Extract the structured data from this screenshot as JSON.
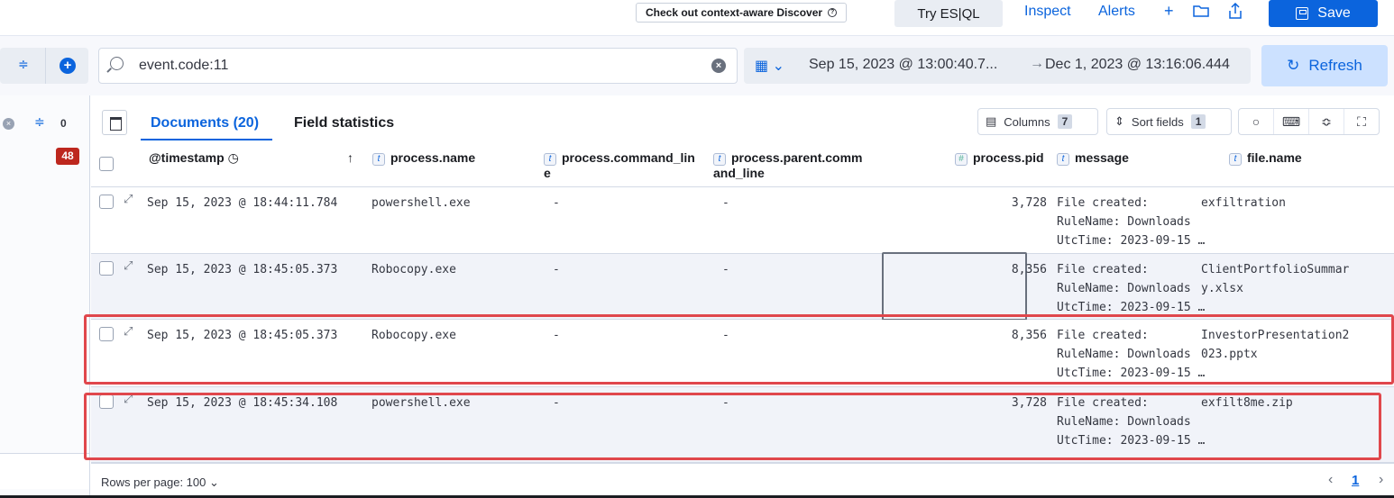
{
  "topbar": {
    "context_label": "Check out context-aware Discover",
    "try_esql": "Try ES|QL",
    "inspect": "Inspect",
    "alerts": "Alerts",
    "save": "Save"
  },
  "search": {
    "query": "event.code:11",
    "date_start": "Sep 15, 2023 @ 13:00:40.7...",
    "date_end": "Dec 1, 2023 @ 13:16:06.444",
    "refresh": "Refresh"
  },
  "sidebar": {
    "filter_count": "0",
    "badge": "48"
  },
  "grid": {
    "tabs": [
      "Documents (20)",
      "Field statistics"
    ],
    "columns_label": "Columns",
    "columns_count": "7",
    "sort_label": "Sort fields",
    "sort_count": "1",
    "headers": {
      "timestamp": "@timestamp",
      "process_name": "process.name",
      "command_line_1": "process.command_lin",
      "command_line_2": "e",
      "parent_cmd_1": "process.parent.comm",
      "parent_cmd_2": "and_line",
      "pid": "process.pid",
      "message": "message",
      "file_name": "file.name"
    },
    "rows": [
      {
        "timestamp": "Sep 15, 2023 @ 18:44:11.784",
        "process": "powershell.exe",
        "cmd": "-",
        "parent": "-",
        "pid": "3,728",
        "msg1": "File created:",
        "msg2": "RuleName: Downloads",
        "msg3": "UtcTime: 2023-09-15 …",
        "file1": "exfiltration",
        "file2": ""
      },
      {
        "timestamp": "Sep 15, 2023 @ 18:45:05.373",
        "process": "Robocopy.exe",
        "cmd": "-",
        "parent": "-",
        "pid": "8,356",
        "msg1": "File created:",
        "msg2": "RuleName: Downloads",
        "msg3": "UtcTime: 2023-09-15 …",
        "file1": "ClientPortfolioSummar",
        "file2": "y.xlsx"
      },
      {
        "timestamp": "Sep 15, 2023 @ 18:45:05.373",
        "process": "Robocopy.exe",
        "cmd": "-",
        "parent": "-",
        "pid": "8,356",
        "msg1": "File created:",
        "msg2": "RuleName: Downloads",
        "msg3": "UtcTime: 2023-09-15 …",
        "file1": "InvestorPresentation2",
        "file2": "023.pptx"
      },
      {
        "timestamp": "Sep 15, 2023 @ 18:45:34.108",
        "process": "powershell.exe",
        "cmd": "-",
        "parent": "-",
        "pid": "3,728",
        "msg1": "File created:",
        "msg2": "RuleName: Downloads",
        "msg3": "UtcTime: 2023-09-15 …",
        "file1": "exfilt8me.zip",
        "file2": ""
      }
    ]
  },
  "footer": {
    "rows_per_page": "Rows per page: 100",
    "page": "1"
  },
  "colors": {
    "accent": "#0b64dd",
    "highlight": "#e0474c",
    "badge": "#bd271e"
  }
}
